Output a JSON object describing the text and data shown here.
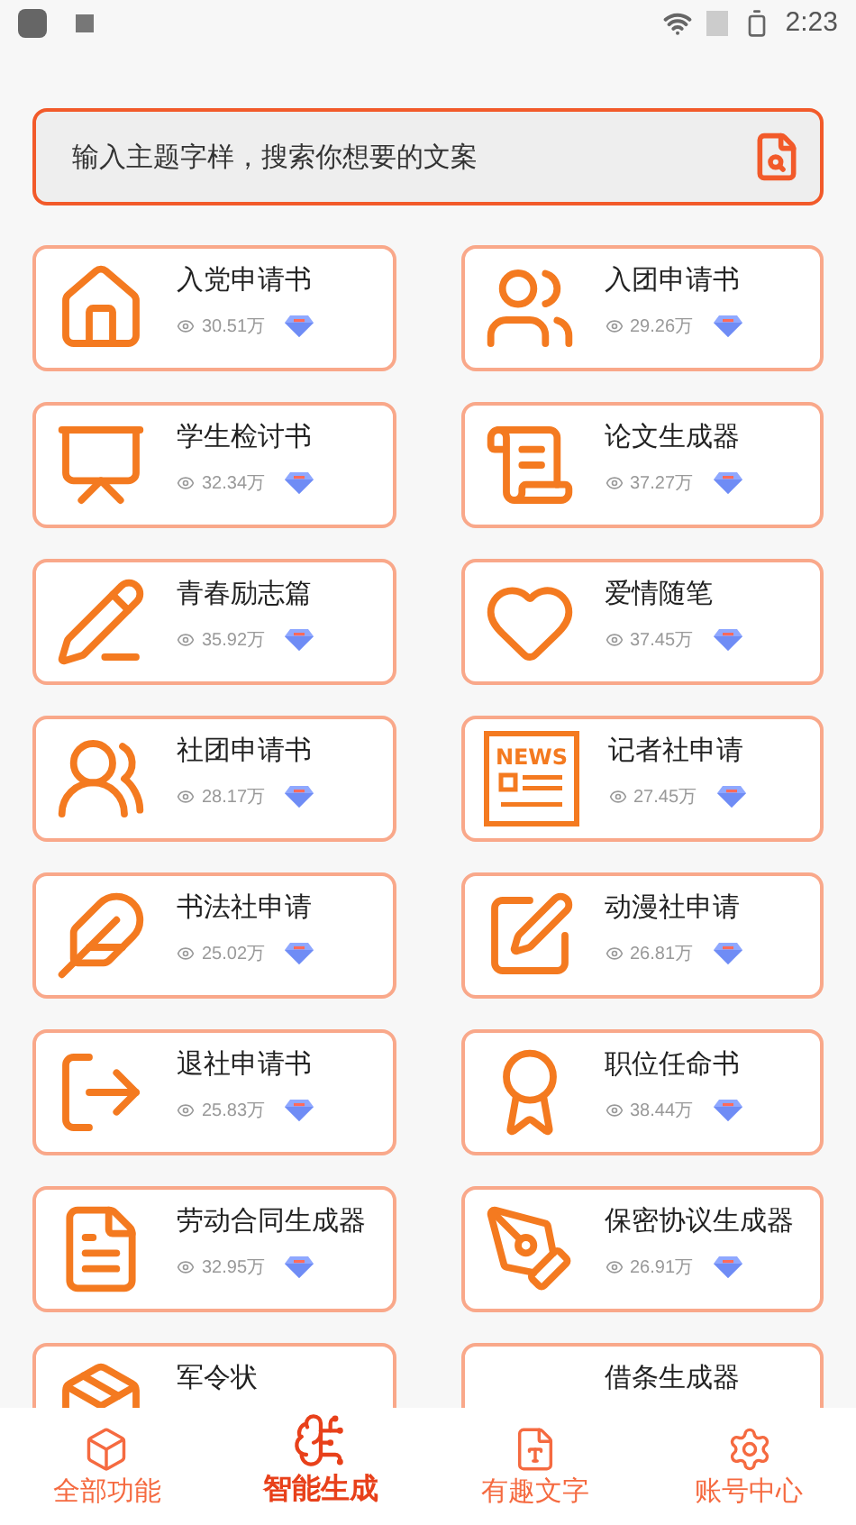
{
  "status_bar": {
    "time": "2:23"
  },
  "search": {
    "placeholder": "输入主题字样，搜索你想要的文案"
  },
  "cards": [
    {
      "title": "入党申请书",
      "views": "30.51万"
    },
    {
      "title": "入团申请书",
      "views": "29.26万"
    },
    {
      "title": "学生检讨书",
      "views": "32.34万"
    },
    {
      "title": "论文生成器",
      "views": "37.27万"
    },
    {
      "title": "青春励志篇",
      "views": "35.92万"
    },
    {
      "title": "爱情随笔",
      "views": "37.45万"
    },
    {
      "title": "社团申请书",
      "views": "28.17万"
    },
    {
      "title": "记者社申请",
      "views": "27.45万",
      "icon_text": "NEWS"
    },
    {
      "title": "书法社申请",
      "views": "25.02万"
    },
    {
      "title": "动漫社申请",
      "views": "26.81万"
    },
    {
      "title": "退社申请书",
      "views": "25.83万"
    },
    {
      "title": "职位任命书",
      "views": "38.44万"
    },
    {
      "title": "劳动合同生成器",
      "views": "32.95万"
    },
    {
      "title": "保密协议生成器",
      "views": "26.91万"
    },
    {
      "title": "军令状"
    },
    {
      "title": "借条生成器"
    }
  ],
  "bottom_nav": [
    {
      "label": "全部功能",
      "selected": false
    },
    {
      "label": "智能生成",
      "selected": true
    },
    {
      "label": "有趣文字",
      "selected": false
    },
    {
      "label": "账号中心",
      "selected": false
    }
  ]
}
